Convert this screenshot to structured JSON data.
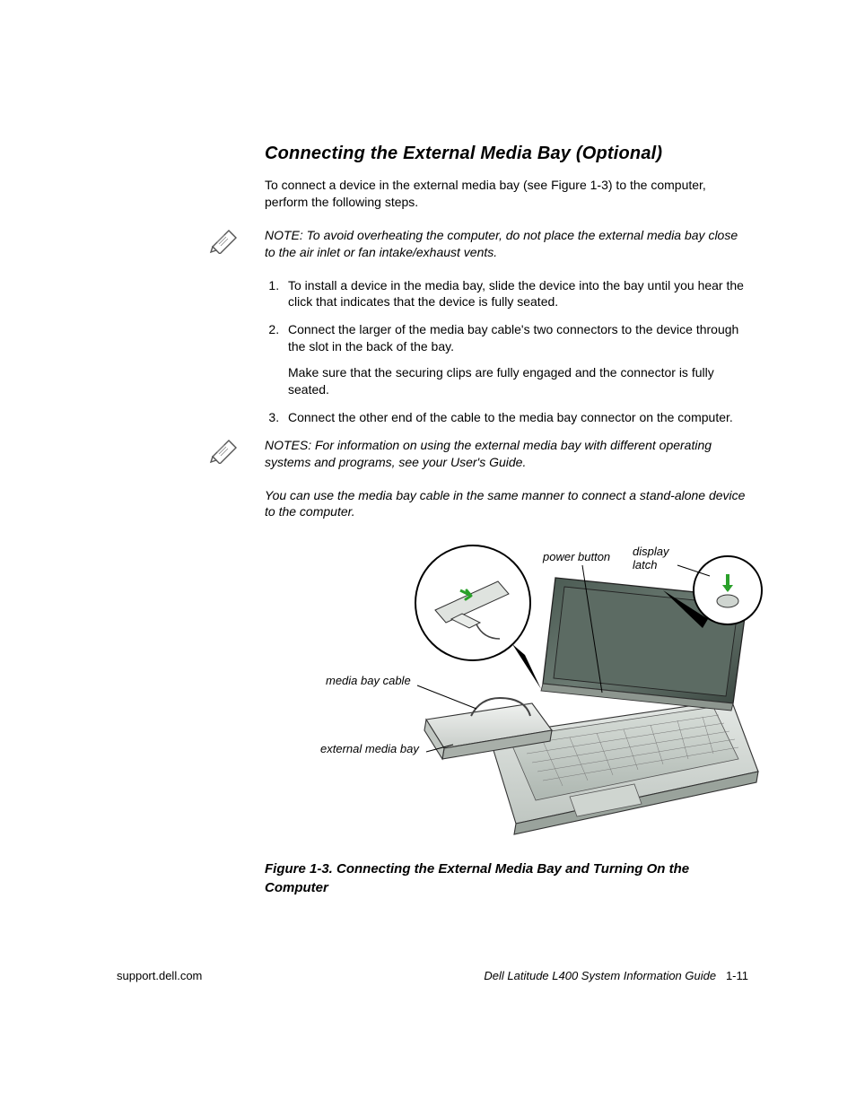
{
  "heading": "Connecting the External Media Bay (Optional)",
  "intro": "To connect a device in the external media bay (see Figure 1-3) to the computer, perform the following steps.",
  "note1": "NOTE: To avoid overheating the computer, do not place the external media bay close to the air inlet or fan intake/exhaust vents.",
  "steps": {
    "s1": "To install a device in the media bay, slide the device into the bay until you hear the click that indicates that the device is fully seated.",
    "s2a": "Connect the larger of the media bay cable's two connectors to the device through the slot in the back of the bay.",
    "s2b": "Make sure that the securing clips are fully engaged and the connector is fully seated.",
    "s3": "Connect the other end of the cable to the media bay connector on the computer."
  },
  "note2a": "NOTES: For information on using the external media bay with different operating systems and programs, see your User's Guide.",
  "note2b": "You can use the media bay cable in the same manner to connect a stand-alone device to the computer.",
  "figure": {
    "labels": {
      "power_button": "power button",
      "display_latch": "display latch",
      "media_bay_cable": "media bay cable",
      "external_media_bay": "external media bay"
    },
    "caption": "Figure 1-3.  Connecting the External Media Bay and Turning On the Computer"
  },
  "footer": {
    "left": "support.dell.com",
    "right_title": "Dell Latitude L400 System Information Guide",
    "page_num": "1-11"
  }
}
